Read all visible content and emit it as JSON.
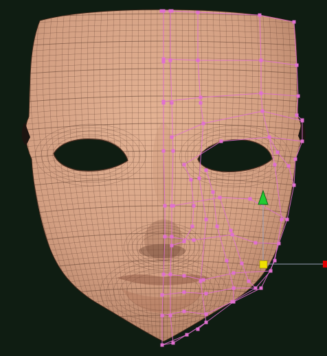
{
  "viewport": {
    "background_color": "#0f1d12",
    "skin_color": "#d9a689",
    "mesh_line_color": "#5a3a2c",
    "cage_color": "#e070d0",
    "gizmo_x_color": "#e00000",
    "gizmo_y_color": "#22cc33",
    "gizmo_center_color": "#f0e000",
    "gizmo_axis_line_color": "#9aa0b8"
  },
  "icons": {
    "gizmo_y_axis": "green-cone-arrow",
    "gizmo_x_axis": "red-square-handle",
    "gizmo_center": "yellow-square-handle"
  }
}
